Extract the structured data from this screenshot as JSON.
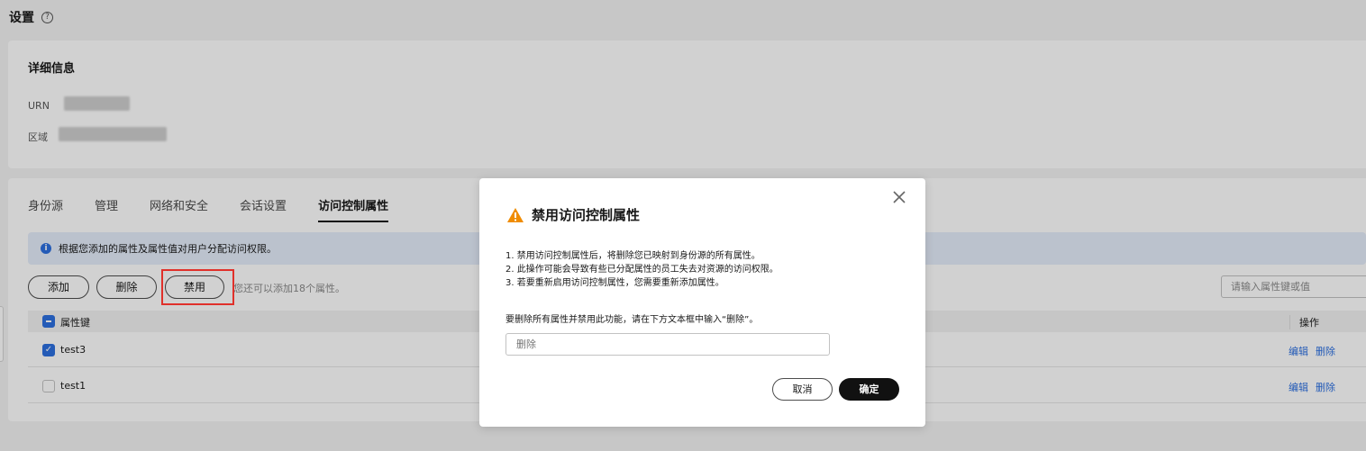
{
  "page": {
    "title": "设置"
  },
  "details": {
    "title": "详细信息",
    "urn_label": "URN",
    "region_label": "区域"
  },
  "tabs": [
    {
      "label": "身份源"
    },
    {
      "label": "管理"
    },
    {
      "label": "网络和安全"
    },
    {
      "label": "会话设置"
    },
    {
      "label": "访问控制属性",
      "active": true
    }
  ],
  "info": {
    "text": "根据您添加的属性及属性值对用户分配访问权限。"
  },
  "toolbar": {
    "add_label": "添加",
    "delete_label": "删除",
    "disable_label": "禁用",
    "hint": "您还可以添加18个属性。",
    "search_placeholder": "请输入属性键或值"
  },
  "table": {
    "col_key": "属性键",
    "col_op": "操作",
    "rows": [
      {
        "key": "test3",
        "checked": true,
        "edit": "编辑",
        "delete": "删除"
      },
      {
        "key": "test1",
        "checked": false,
        "edit": "编辑",
        "delete": "删除"
      }
    ]
  },
  "dialog": {
    "title": "禁用访问控制属性",
    "items": [
      "1. 禁用访问控制属性后，将删除您已映射到身份源的所有属性。",
      "2. 此操作可能会导致有些已分配属性的员工失去对资源的访问权限。",
      "3. 若要重新启用访问控制属性，您需要重新添加属性。"
    ],
    "prompt": "要删除所有属性并禁用此功能，请在下方文本框中输入“删除”。",
    "input_placeholder": "删除",
    "cancel_label": "取消",
    "ok_label": "确定"
  },
  "colors": {
    "accent": "#2c6fe0",
    "warning": "#f08c00",
    "highlight": "#e0302a",
    "primary_button": "#111111"
  }
}
